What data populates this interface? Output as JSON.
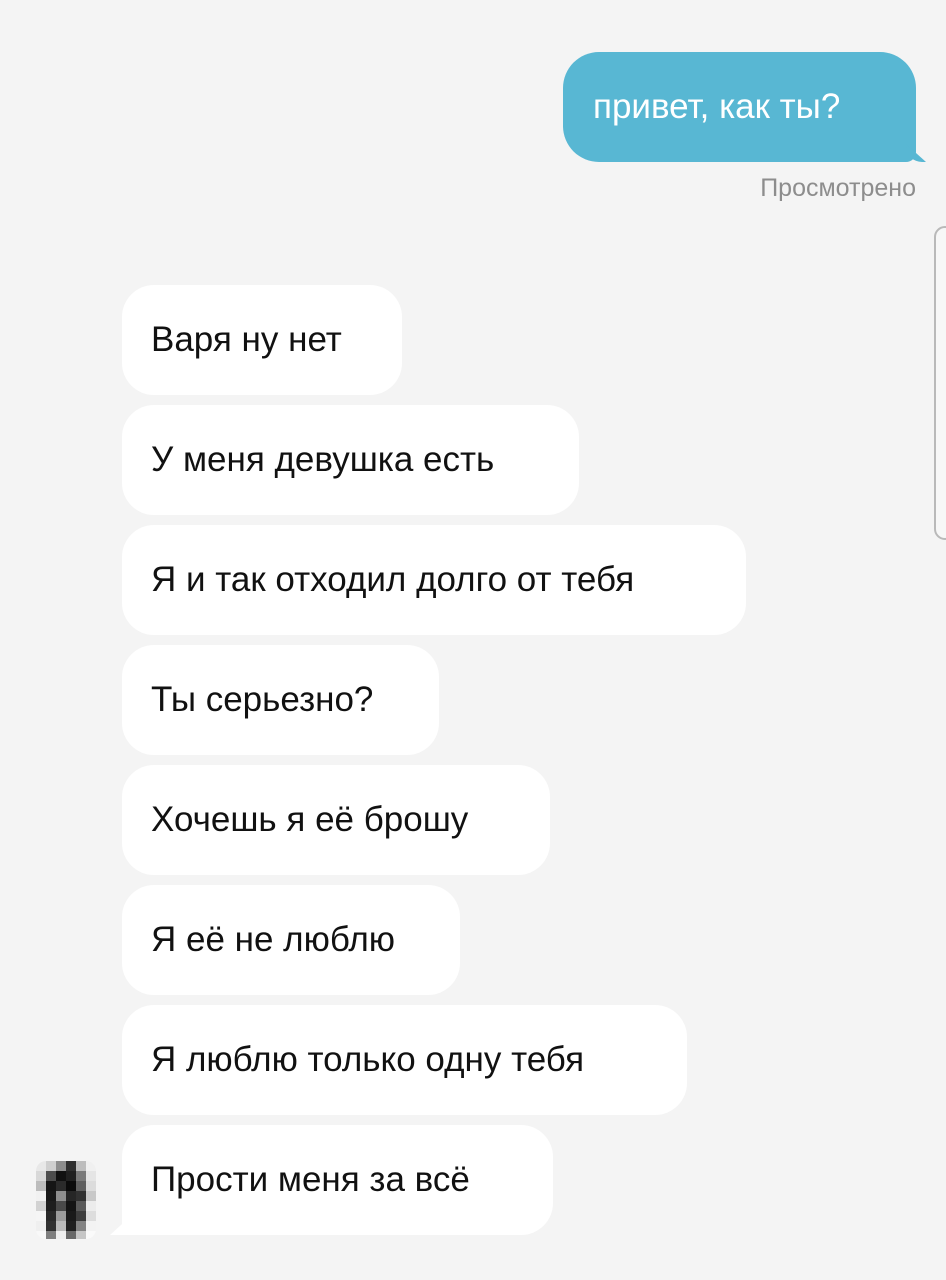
{
  "conversation": {
    "outgoing": [
      {
        "text": "привет, как ты?",
        "status": "Просмотрено"
      }
    ],
    "incoming": [
      {
        "text": "Варя ну нет"
      },
      {
        "text": "У меня девушка есть"
      },
      {
        "text": "Я и так отходил долго от тебя"
      },
      {
        "text": "Ты серьезно?"
      },
      {
        "text": "Хочешь я её брошу"
      },
      {
        "text": "Я её не люблю"
      },
      {
        "text": "Я люблю только одну тебя"
      },
      {
        "text": "Прости меня за всё"
      }
    ]
  },
  "avatar": {
    "icon": "pixelated-avatar-icon"
  },
  "colors": {
    "background": "#f4f4f4",
    "outgoing_bubble": "#58b7d3",
    "incoming_bubble": "#ffffff",
    "status_text": "#8d8d8d"
  }
}
